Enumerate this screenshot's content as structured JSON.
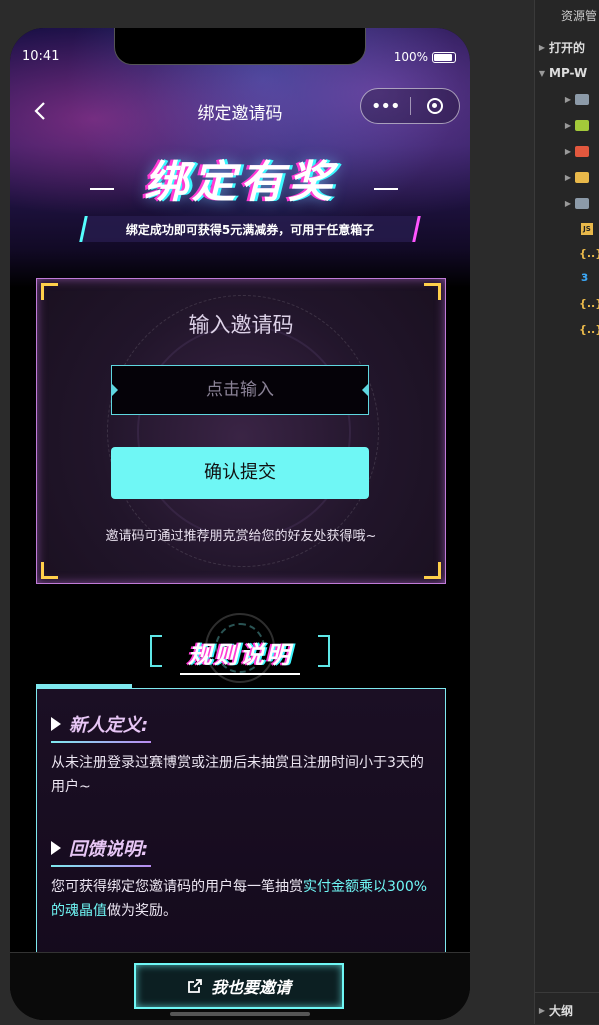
{
  "status": {
    "time": "10:41",
    "battery": "100%"
  },
  "nav": {
    "title": "绑定邀请码",
    "more": "•••"
  },
  "hero": {
    "title": "绑定有奖",
    "subtitle": "绑定成功即可获得5元满减券，可用于任意箱子"
  },
  "invite": {
    "title": "输入邀请码",
    "input_placeholder": "点击输入",
    "submit_label": "确认提交",
    "hint": "邀请码可通过推荐朋克赏给您的好友处获得哦~"
  },
  "rules": {
    "title": "规则说明",
    "sections": [
      {
        "heading": "新人定义:",
        "text": "从未注册登录过赛博赏或注册后未抽赏且注册时间小于3天的用户~"
      },
      {
        "heading": "回馈说明:",
        "text_before": "您可获得绑定您邀请码的用户每一笔抽赏",
        "text_highlight": "实付金额乘以300%的魂晶值",
        "text_after": "做为奖励。"
      }
    ]
  },
  "bottom": {
    "invite_label": "我也要邀请"
  },
  "ide": {
    "panel_title": "资源管",
    "open_label": "打开的",
    "project_label": "MP-W",
    "outline_label": "大纲"
  },
  "colors": {
    "accent_cyan": "#6ff7f5",
    "accent_pink": "#e7c6f5",
    "card_border": "#c07bd8"
  }
}
